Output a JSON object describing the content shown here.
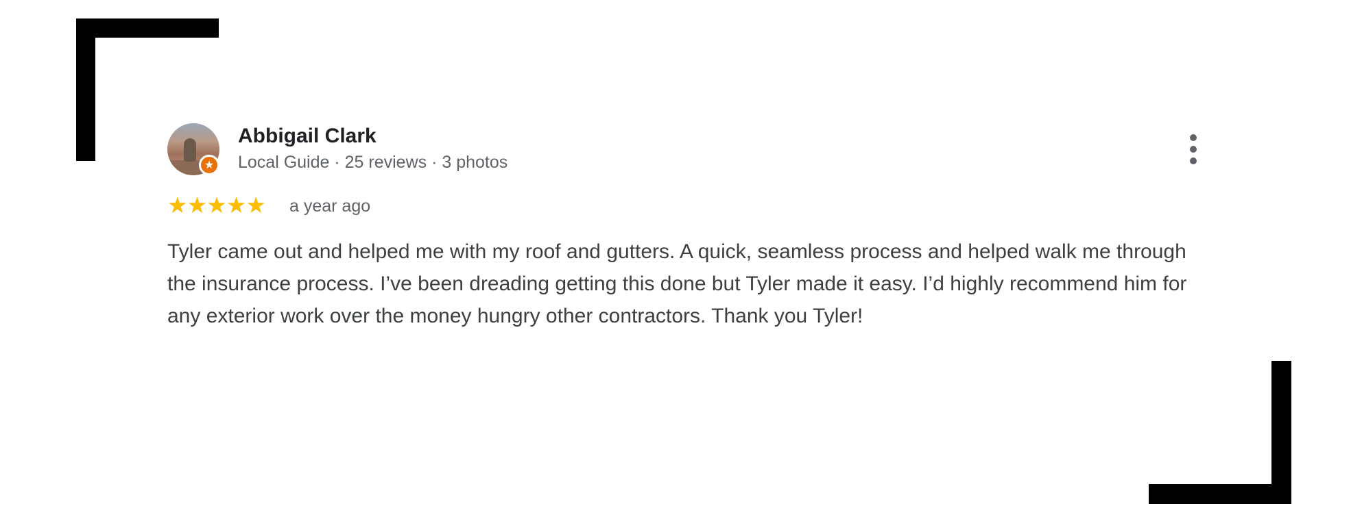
{
  "review": {
    "author_name": "Abbigail Clark",
    "author_meta": "Local Guide · 25 reviews · 3 photos",
    "badge": "local-guide-star",
    "rating": 5,
    "rating_max": 5,
    "stars": [
      "★",
      "★",
      "★",
      "★",
      "★"
    ],
    "date": "a year ago",
    "text": "Tyler came out and helped me with my roof and gutters. A quick, seamless process and helped walk me through the insurance process. I’ve been dreading getting this done but Tyler made it easy. I’d highly recommend him for any exterior work over the money hungry other contractors. Thank you Tyler!",
    "star_color": "#fbbc04",
    "badge_color": "#e8710a"
  },
  "icons": {
    "more": "more-vert-icon",
    "badge": "star-badge-icon"
  }
}
